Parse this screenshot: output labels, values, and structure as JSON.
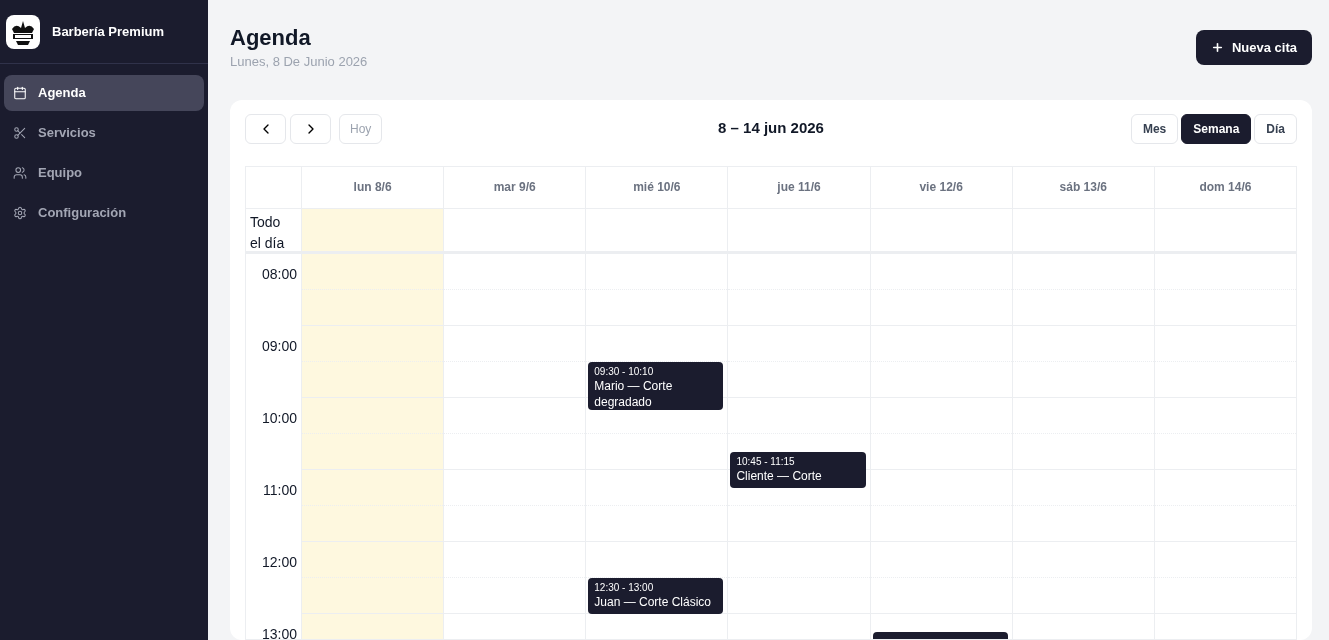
{
  "sidebar": {
    "brand": "Barbería Premium",
    "items": [
      {
        "label": "Agenda",
        "kind": "calendar",
        "selected": true
      },
      {
        "label": "Servicios",
        "kind": "scissors",
        "selected": false
      },
      {
        "label": "Equipo",
        "kind": "users",
        "selected": false
      },
      {
        "label": "Configuración",
        "kind": "settings",
        "selected": false
      }
    ]
  },
  "header": {
    "title": "Agenda",
    "subtitle": "Lunes, 8 De Junio 2026",
    "new_button": "Nueva cita"
  },
  "calendar": {
    "today_button": "Hoy",
    "range": "8 – 14 jun 2026",
    "views": [
      {
        "label": "Mes",
        "selected": false
      },
      {
        "label": "Semana",
        "selected": true
      },
      {
        "label": "Día",
        "selected": false
      }
    ],
    "all_day_label": "Todo el día",
    "hours": [
      "08:00",
      "09:00",
      "10:00",
      "11:00",
      "12:00",
      "13:00"
    ],
    "days": [
      {
        "label": "lun 8/6",
        "today": true
      },
      {
        "label": "mar 9/6",
        "today": false
      },
      {
        "label": "mié 10/6",
        "today": false,
        "events": [
          {
            "time": "09:30 - 10:10",
            "title": "Mario — Corte degradado"
          },
          {
            "time": "12:30 - 13:00",
            "title": "Juan — Corte Clásico"
          }
        ]
      },
      {
        "label": "jue 11/6",
        "today": false,
        "events": [
          {
            "time": "10:45 - 11:15",
            "title": "Cliente — Corte"
          }
        ]
      },
      {
        "label": "vie 12/6",
        "today": false,
        "cut_off_event": true
      },
      {
        "label": "sáb 13/6",
        "today": false
      },
      {
        "label": "dom 14/6",
        "today": false
      }
    ]
  }
}
